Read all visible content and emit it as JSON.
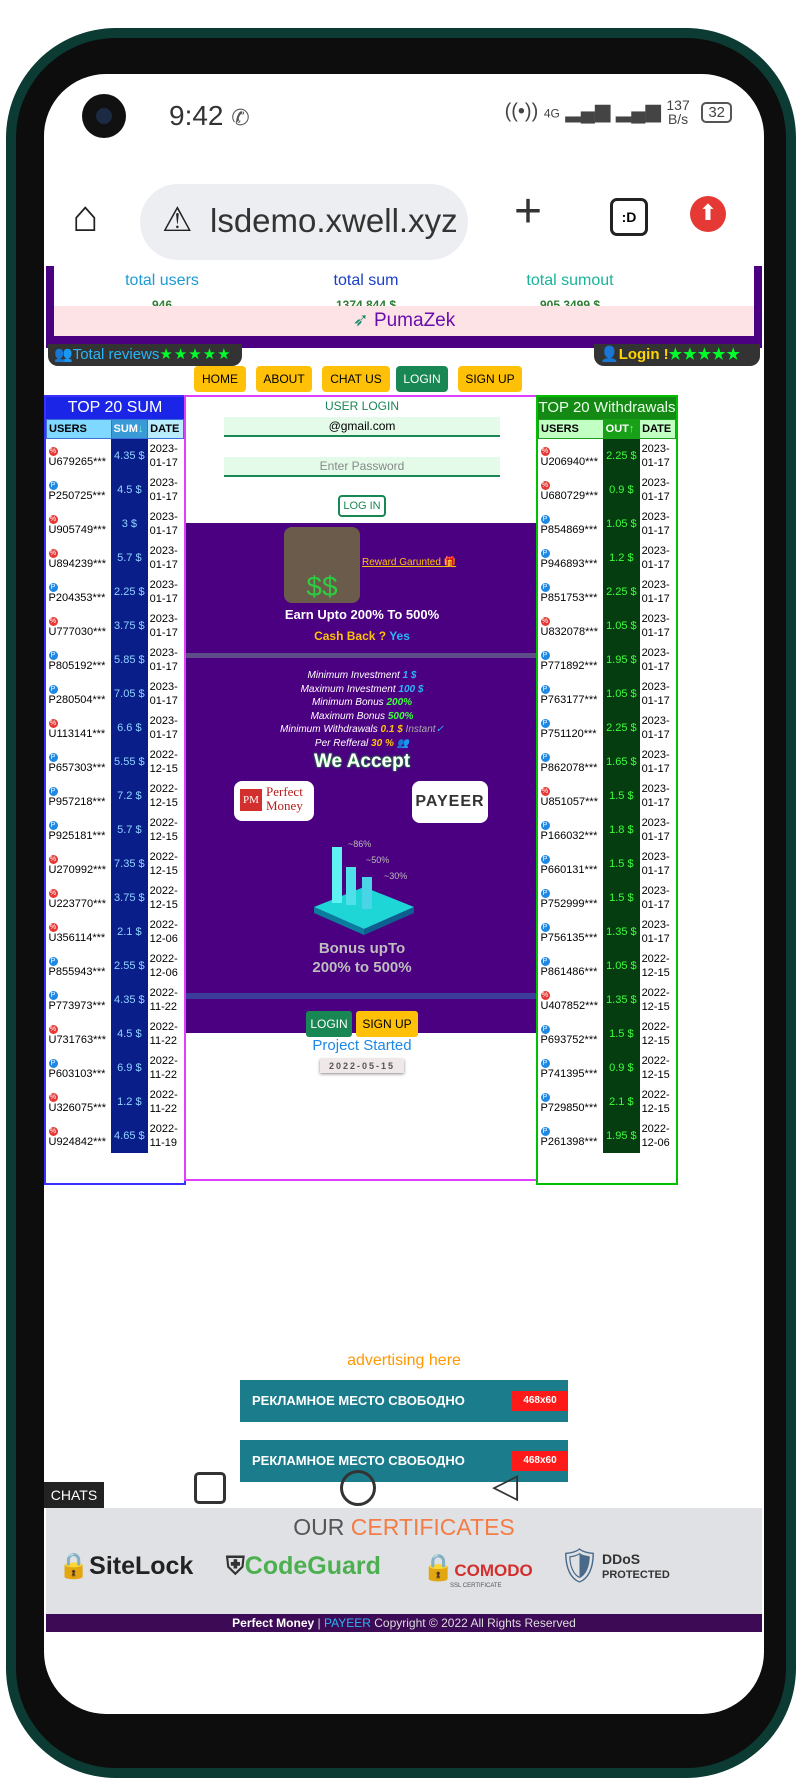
{
  "status": {
    "time": "9:42",
    "net": "4G",
    "speed_value": "137",
    "speed_unit": "B/s",
    "battery": "32"
  },
  "browser": {
    "url": "lsdemo.xwell.xyz"
  },
  "stats": {
    "users_label": "total users",
    "users_value": "946",
    "sum_label": "total sum",
    "sum_value": "1374.844 $",
    "sumout_label": "total sumout",
    "sumout_value": "905.3499 $",
    "brand": "PumaZek"
  },
  "reviews": {
    "label": "Total reviews",
    "stars": "★★★★★"
  },
  "login_top": {
    "label": "Login !",
    "stars": "★★★★★"
  },
  "nav": [
    "HOME",
    "ABOUT",
    "CHAT US",
    "LOGIN",
    "SIGN UP"
  ],
  "top_sum": {
    "title": "TOP 20 SUM",
    "headers": [
      "USERS",
      "SUM",
      "DATE"
    ],
    "rows": [
      {
        "t": "r",
        "u": "U679265***",
        "v": "4.35",
        "d1": "2023-",
        "d2": "01-17"
      },
      {
        "t": "p",
        "u": "P250725***",
        "v": "4.5",
        "d1": "2023-",
        "d2": "01-17"
      },
      {
        "t": "r",
        "u": "U905749***",
        "v": "3",
        "d1": "2023-",
        "d2": "01-17"
      },
      {
        "t": "r",
        "u": "U894239***",
        "v": "5.7",
        "d1": "2023-",
        "d2": "01-17"
      },
      {
        "t": "p",
        "u": "P204353***",
        "v": "2.25",
        "d1": "2023-",
        "d2": "01-17"
      },
      {
        "t": "r",
        "u": "U777030***",
        "v": "3.75",
        "d1": "2023-",
        "d2": "01-17"
      },
      {
        "t": "p",
        "u": "P805192***",
        "v": "5.85",
        "d1": "2023-",
        "d2": "01-17"
      },
      {
        "t": "p",
        "u": "P280504***",
        "v": "7.05",
        "d1": "2023-",
        "d2": "01-17"
      },
      {
        "t": "r",
        "u": "U113141***",
        "v": "6.6",
        "d1": "2023-",
        "d2": "01-17"
      },
      {
        "t": "p",
        "u": "P657303***",
        "v": "5.55",
        "d1": "2022-",
        "d2": "12-15"
      },
      {
        "t": "p",
        "u": "P957218***",
        "v": "7.2",
        "d1": "2022-",
        "d2": "12-15"
      },
      {
        "t": "p",
        "u": "P925181***",
        "v": "5.7",
        "d1": "2022-",
        "d2": "12-15"
      },
      {
        "t": "r",
        "u": "U270992***",
        "v": "7.35",
        "d1": "2022-",
        "d2": "12-15"
      },
      {
        "t": "r",
        "u": "U223770***",
        "v": "3.75",
        "d1": "2022-",
        "d2": "12-15"
      },
      {
        "t": "r",
        "u": "U356114***",
        "v": "2.1",
        "d1": "2022-",
        "d2": "12-06"
      },
      {
        "t": "p",
        "u": "P855943***",
        "v": "2.55",
        "d1": "2022-",
        "d2": "12-06"
      },
      {
        "t": "p",
        "u": "P773973***",
        "v": "4.35",
        "d1": "2022-",
        "d2": "11-22"
      },
      {
        "t": "r",
        "u": "U731763***",
        "v": "4.5",
        "d1": "2022-",
        "d2": "11-22"
      },
      {
        "t": "p",
        "u": "P603103***",
        "v": "6.9",
        "d1": "2022-",
        "d2": "11-22"
      },
      {
        "t": "r",
        "u": "U326075***",
        "v": "1.2",
        "d1": "2022-",
        "d2": "11-22"
      },
      {
        "t": "r",
        "u": "U924842***",
        "v": "4.65",
        "d1": "2022-",
        "d2": "11-19"
      }
    ]
  },
  "top_withdrawals": {
    "title": "TOP 20 Withdrawals",
    "headers": [
      "USERS",
      "OUT",
      "DATE"
    ],
    "rows": [
      {
        "t": "r",
        "u": "U206940***",
        "v": "2.25",
        "d1": "2023-",
        "d2": "01-17"
      },
      {
        "t": "r",
        "u": "U680729***",
        "v": "0.9",
        "d1": "2023-",
        "d2": "01-17"
      },
      {
        "t": "p",
        "u": "P854869***",
        "v": "1.05",
        "d1": "2023-",
        "d2": "01-17"
      },
      {
        "t": "p",
        "u": "P946893***",
        "v": "1.2",
        "d1": "2023-",
        "d2": "01-17"
      },
      {
        "t": "p",
        "u": "P851753***",
        "v": "2.25",
        "d1": "2023-",
        "d2": "01-17"
      },
      {
        "t": "r",
        "u": "U832078***",
        "v": "1.05",
        "d1": "2023-",
        "d2": "01-17"
      },
      {
        "t": "p",
        "u": "P771892***",
        "v": "1.95",
        "d1": "2023-",
        "d2": "01-17"
      },
      {
        "t": "p",
        "u": "P763177***",
        "v": "1.05",
        "d1": "2023-",
        "d2": "01-17"
      },
      {
        "t": "p",
        "u": "P751120***",
        "v": "2.25",
        "d1": "2023-",
        "d2": "01-17"
      },
      {
        "t": "p",
        "u": "P862078***",
        "v": "1.65",
        "d1": "2023-",
        "d2": "01-17"
      },
      {
        "t": "r",
        "u": "U851057***",
        "v": "1.5",
        "d1": "2023-",
        "d2": "01-17"
      },
      {
        "t": "p",
        "u": "P166032***",
        "v": "1.8",
        "d1": "2023-",
        "d2": "01-17"
      },
      {
        "t": "p",
        "u": "P660131***",
        "v": "1.5",
        "d1": "2023-",
        "d2": "01-17"
      },
      {
        "t": "p",
        "u": "P752999***",
        "v": "1.5",
        "d1": "2023-",
        "d2": "01-17"
      },
      {
        "t": "p",
        "u": "P756135***",
        "v": "1.35",
        "d1": "2023-",
        "d2": "01-17"
      },
      {
        "t": "p",
        "u": "P861486***",
        "v": "1.05",
        "d1": "2022-",
        "d2": "12-15"
      },
      {
        "t": "r",
        "u": "U407852***",
        "v": "1.35",
        "d1": "2022-",
        "d2": "12-15"
      },
      {
        "t": "p",
        "u": "P693752***",
        "v": "1.5",
        "d1": "2022-",
        "d2": "12-15"
      },
      {
        "t": "p",
        "u": "P741395***",
        "v": "0.9",
        "d1": "2022-",
        "d2": "12-15"
      },
      {
        "t": "p",
        "u": "P729850***",
        "v": "2.1",
        "d1": "2022-",
        "d2": "12-15"
      },
      {
        "t": "p",
        "u": "P261398***",
        "v": "1.95",
        "d1": "2022-",
        "d2": "12-06"
      }
    ]
  },
  "login_form": {
    "title": "USER LOGIN",
    "email_value": "@gmail.com",
    "password_placeholder": "Enter Password",
    "button": "LOG IN"
  },
  "promo": {
    "reward": "Reward Garunted",
    "earn": "Earn Upto 200% To 500%",
    "cashback": "Cash Back ?",
    "cashback_yes": "Yes",
    "info": [
      {
        "k": "Minimum Investment",
        "v": "1 $"
      },
      {
        "k": "Maximum Investment",
        "v": "100 $"
      },
      {
        "k": "Minimum Bonus",
        "v": "200%"
      },
      {
        "k": "Maximum Bonus",
        "v": "500%"
      },
      {
        "k": "Minimum Withdrawals",
        "v": "0.1 $",
        "extra": "Instant"
      },
      {
        "k": "Per Refferal",
        "v": "30 %"
      }
    ],
    "we_accept": "We Accept",
    "pm_1": "Perfect",
    "pm_2": "Money",
    "payeer": "PAYEER",
    "graph_labels": [
      "~86%",
      "~50%",
      "~30%"
    ],
    "bonus_1": "Bonus upTo",
    "bonus_2": "200% to 500%",
    "login_btn": "LOGIN",
    "signup_btn": "SIGN UP",
    "project_started": "Project Started",
    "start_date": "2022-05-15"
  },
  "ads": {
    "label": "advertising here",
    "banner1": "РЕКЛАМНОЕ  МЕСТО СВОБОДНО",
    "banner2": "РЕКЛАМНОЕ  МЕСТО СВОБОДНО",
    "size": "468x60"
  },
  "chats": "CHATS",
  "certs": {
    "title_a": "OUR ",
    "title_b": "CERTIFICATES",
    "sitelock": "SiteLock",
    "codeguard": "CodeGuard",
    "comodo": "COMODO",
    "comodo_sub": "SSL CERTIFICATE",
    "ddos_1": "DDoS",
    "ddos_2": "PROTECTED"
  },
  "footer": {
    "pm": "Perfect Money",
    "sep": " | ",
    "payeer": "PAYEER",
    "copyright": "Copyright © 2022 All Rights Reserved"
  }
}
